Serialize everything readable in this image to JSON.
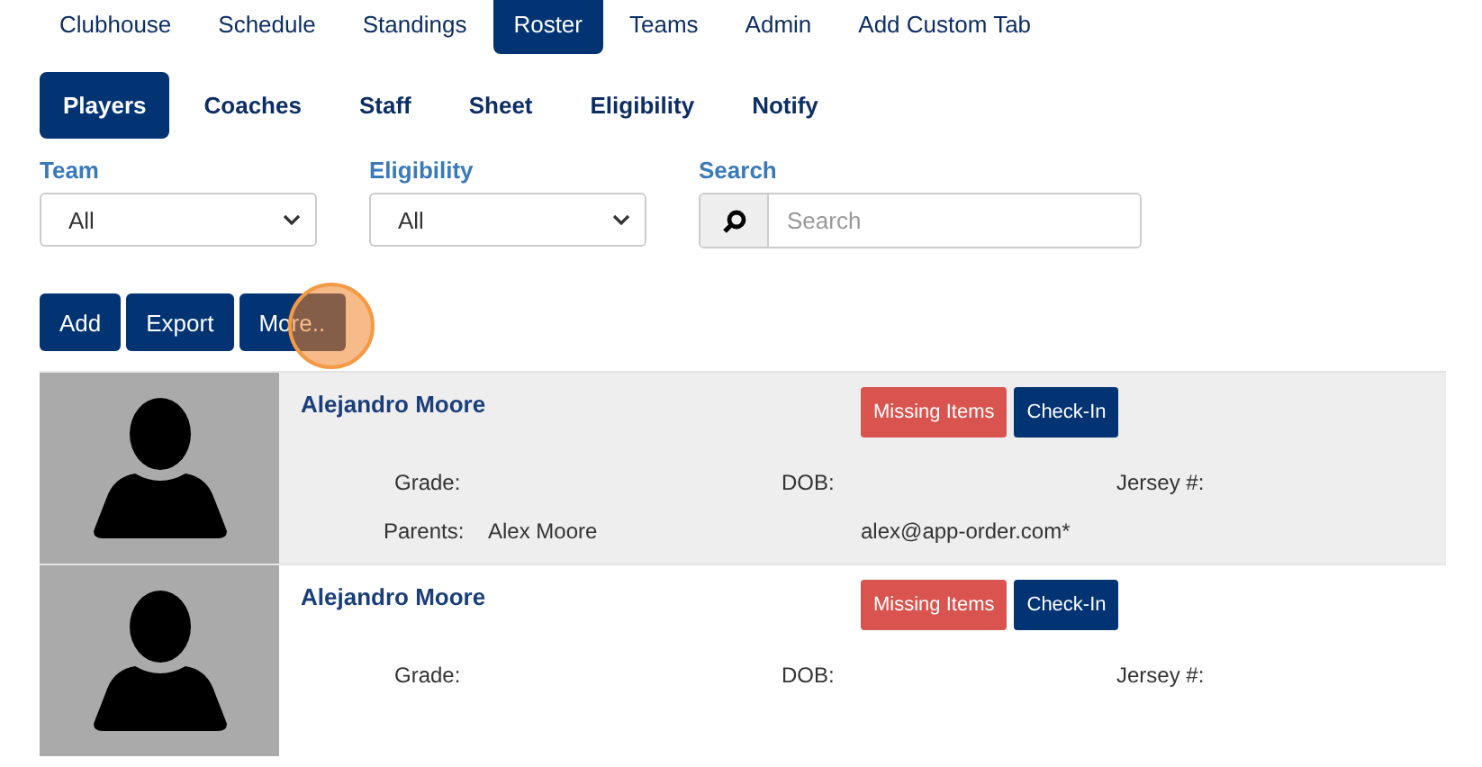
{
  "main_tabs": [
    {
      "label": "Clubhouse",
      "selected": false
    },
    {
      "label": "Schedule",
      "selected": false
    },
    {
      "label": "Standings",
      "selected": false
    },
    {
      "label": "Roster",
      "selected": true
    },
    {
      "label": "Teams",
      "selected": false
    },
    {
      "label": "Admin",
      "selected": false
    },
    {
      "label": "Add Custom Tab",
      "selected": false
    }
  ],
  "sub_tabs": [
    {
      "label": "Players",
      "selected": true
    },
    {
      "label": "Coaches",
      "selected": false
    },
    {
      "label": "Staff",
      "selected": false
    },
    {
      "label": "Sheet",
      "selected": false
    },
    {
      "label": "Eligibility",
      "selected": false
    },
    {
      "label": "Notify",
      "selected": false
    }
  ],
  "filters": {
    "team": {
      "label": "Team",
      "value": "All"
    },
    "eligibility": {
      "label": "Eligibility",
      "value": "All"
    },
    "search": {
      "label": "Search",
      "placeholder": "Search"
    }
  },
  "actions": [
    {
      "label": "Add",
      "highlighted": false
    },
    {
      "label": "Export",
      "highlighted": false
    },
    {
      "label": "More..",
      "highlighted": true
    }
  ],
  "players": [
    {
      "name": "Alejandro Moore",
      "missing_button": "Missing Items",
      "checkin_button": "Check-In",
      "grade_label": "Grade:",
      "dob_label": "DOB:",
      "jersey_label": "Jersey #:",
      "parents_label": "Parents:",
      "parents": "Alex Moore",
      "email": "alex@app-order.com*",
      "shaded": true
    },
    {
      "name": "Alejandro Moore",
      "missing_button": "Missing Items",
      "checkin_button": "Check-In",
      "grade_label": "Grade:",
      "dob_label": "DOB:",
      "jersey_label": "Jersey #:",
      "shaded": false
    }
  ]
}
